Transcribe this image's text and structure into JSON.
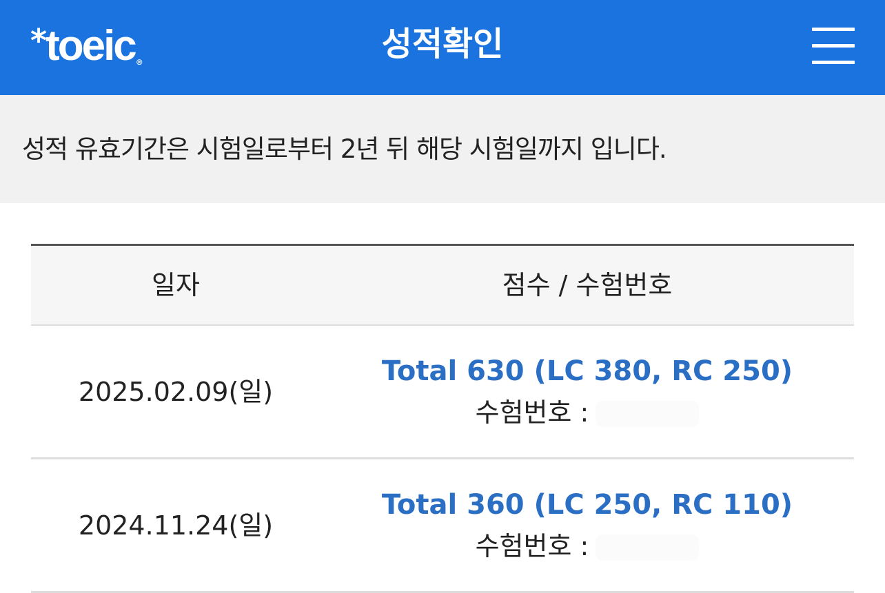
{
  "header": {
    "logo_star": "*",
    "logo_text": "toeic",
    "logo_reg": "®",
    "title": "성적확인",
    "menu_icon": "hamburger-menu-icon",
    "background_color": "#1a73de"
  },
  "notice": {
    "text": "성적 유효기간은 시험일로부터 2년 뒤 해당 시험일까지 입니다."
  },
  "table": {
    "headers": {
      "date": "일자",
      "score": "점수 / 수험번호"
    },
    "rows": [
      {
        "date": "2025.02.09(일)",
        "score": "Total 630 (LC 380, RC 250)",
        "exam_label": "수험번호 :"
      },
      {
        "date": "2024.11.24(일)",
        "score": "Total 360 (LC 250, RC 110)",
        "exam_label": "수험번호 :"
      }
    ],
    "score_color": "#2b6fc4"
  }
}
